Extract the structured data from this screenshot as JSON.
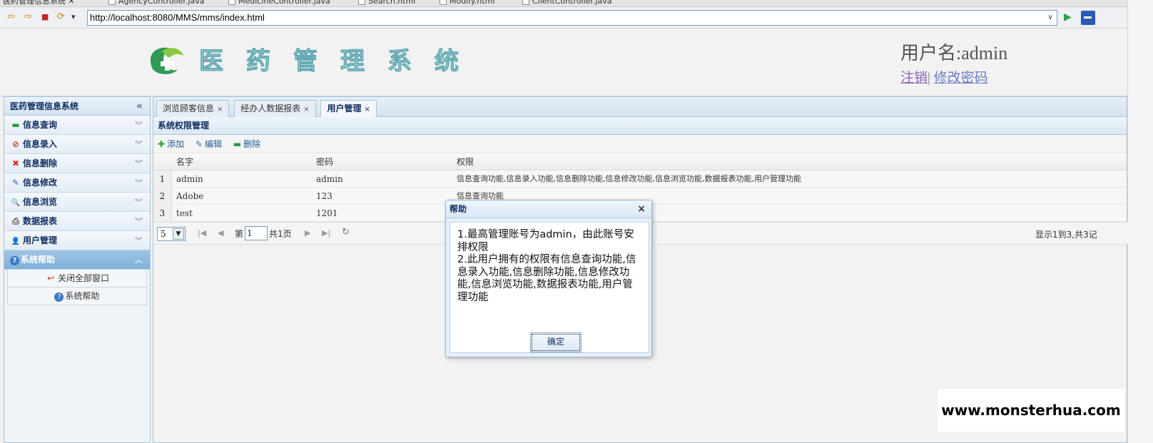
{
  "editor_tabs": [
    "医药管理信息系统",
    "AgencyController.java",
    "MedicineController.java",
    "Search.html",
    "Modify.html",
    "ClientController.java"
  ],
  "browser": {
    "url": "http://localhost:8080/MMS/mms/index.html",
    "back_icon": "⇦",
    "forward_icon": "⇨",
    "stop_icon": "■",
    "refresh_icon": "⟳",
    "menu_icon": "▾",
    "dropdown_icon": "∨",
    "go_icon": "▶"
  },
  "header": {
    "logo_text": [
      "医",
      "药",
      "管",
      "理",
      "系",
      "统"
    ],
    "user_name": "用户名:admin",
    "logout": "注销",
    "separator": "|",
    "change_password": "修改密码",
    "logo_color": "#64aab2"
  },
  "sidebar": {
    "title": "医药管理信息系统",
    "collapse_icon": "«",
    "items": [
      {
        "label": "信息查询",
        "icon": "▬",
        "chevron": "︾"
      },
      {
        "label": "信息录入",
        "icon": "⊘",
        "chevron": "︾"
      },
      {
        "label": "信息删除",
        "icon": "✖",
        "chevron": "︾"
      },
      {
        "label": "信息修改",
        "icon": "✎",
        "chevron": "︾"
      },
      {
        "label": "信息浏览",
        "icon": "🔍",
        "chevron": "︾"
      },
      {
        "label": "数据报表",
        "icon": "⎙",
        "chevron": "︾"
      },
      {
        "label": "用户管理",
        "icon": "👤",
        "chevron": "︾"
      },
      {
        "label": "系统帮助",
        "icon": "?",
        "chevron": "︽"
      }
    ],
    "sub_items": [
      {
        "label": "关闭全部窗口",
        "icon": "↩"
      },
      {
        "label": "系统帮助",
        "icon": "?"
      }
    ]
  },
  "tabs": [
    {
      "label": "浏览顾客信息",
      "close": "×"
    },
    {
      "label": "经办人数据报表",
      "close": "×"
    },
    {
      "label": "用户管理",
      "close": "×"
    }
  ],
  "panel": {
    "title": "系统权限管理",
    "toolbar": [
      {
        "label": "添加",
        "icon": "✚"
      },
      {
        "label": "编辑",
        "icon": "✎"
      },
      {
        "label": "删除",
        "icon": "▬"
      }
    ],
    "columns": [
      "名字",
      "密码",
      "权限"
    ],
    "rows": [
      {
        "num": "1",
        "name": "admin",
        "password": "admin",
        "permissions": "信息查询功能,信息录入功能,信息删除功能,信息修改功能,信息浏览功能,数据报表功能,用户管理功能"
      },
      {
        "num": "2",
        "name": "Adobe",
        "password": "123",
        "permissions": "信息查询功能"
      },
      {
        "num": "3",
        "name": "test",
        "password": "1201",
        "permissions": ""
      }
    ]
  },
  "pager": {
    "page_size": "5",
    "page_label": "第",
    "page_value": "1",
    "total_pages": "共1页",
    "info": "显示1到3,共3记",
    "first_icon": "|◀",
    "prev_icon": "◀",
    "next_icon": "▶",
    "last_icon": "▶|",
    "refresh_icon": "↻"
  },
  "dialog": {
    "title": "帮助",
    "close_icon": "×",
    "message": "1.最高管理账号为admin，由此账号安排权限\n2.此用户拥有的权限有信息查询功能,信息录入功能,信息删除功能,信息修改功能,信息浏览功能,数据报表功能,用户管理功能",
    "ok_label": "确定"
  },
  "watermark": "www.monsterhua.com"
}
